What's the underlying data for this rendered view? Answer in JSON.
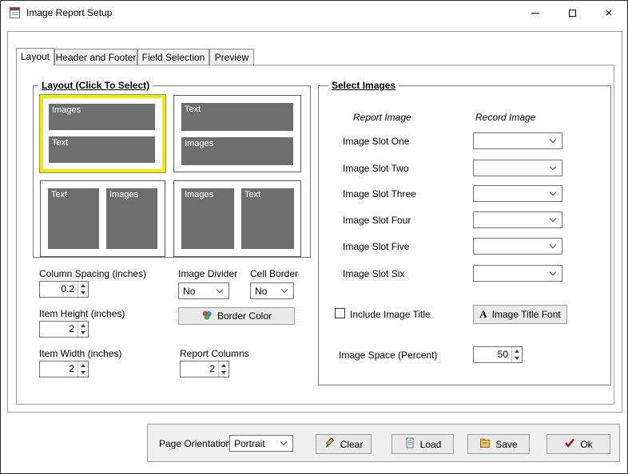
{
  "window": {
    "title": "Image Report Setup",
    "close_glyph": "×"
  },
  "tabs": [
    {
      "label": "Layout"
    },
    {
      "label": "Header and Footer"
    },
    {
      "label": "Field Selection"
    },
    {
      "label": "Preview"
    }
  ],
  "active_tab": "Layout",
  "layout_group": {
    "title": "Layout (Click To Select)",
    "options": [
      {
        "blocks": [
          "Images",
          "Text"
        ],
        "selected": true
      },
      {
        "blocks": [
          "Text",
          "Images"
        ],
        "selected": false
      },
      {
        "blocks": [
          "Text",
          "Images"
        ],
        "selected": false
      },
      {
        "blocks": [
          "Images",
          "Text"
        ],
        "selected": false
      }
    ],
    "column_spacing": {
      "label": "Column Spacing (inches)",
      "value": "0.2"
    },
    "image_divider": {
      "label": "Image Divider",
      "value": "No"
    },
    "cell_border": {
      "label": "Cell Border",
      "value": "No"
    },
    "border_color_button": "Border Color",
    "item_height": {
      "label": "Item Height (inches)",
      "value": "2"
    },
    "item_width": {
      "label": "Item Width (inches)",
      "value": "2"
    },
    "report_columns": {
      "label": "Report Columns",
      "value": "2"
    }
  },
  "select_images_group": {
    "title": "Select Images",
    "report_image_header": "Report Image",
    "record_image_header": "Record Image",
    "slots": [
      {
        "label": "Image Slot One",
        "value": ""
      },
      {
        "label": "Image Slot Two",
        "value": ""
      },
      {
        "label": "Image Slot Three",
        "value": ""
      },
      {
        "label": "Image Slot Four",
        "value": ""
      },
      {
        "label": "Image Slot Five",
        "value": ""
      },
      {
        "label": "Image Slot Six",
        "value": ""
      }
    ],
    "include_image_title": {
      "label": "Include Image Title",
      "checked": false
    },
    "image_title_font_button": "Image Title Font",
    "font_icon_glyph": "A",
    "image_space": {
      "label": "Image Space (Percent)",
      "value": "50"
    }
  },
  "bottom_bar": {
    "page_orientation": {
      "label": "Page Orientation",
      "value": "Portrait"
    },
    "clear_button": "Clear",
    "load_button": "Load",
    "save_button": "Save",
    "ok_button": "Ok"
  },
  "colors": {
    "selected_outline": "#f0ea00",
    "placeholder_gray": "#6e6e6e",
    "ok_check_red": "#b00020"
  }
}
